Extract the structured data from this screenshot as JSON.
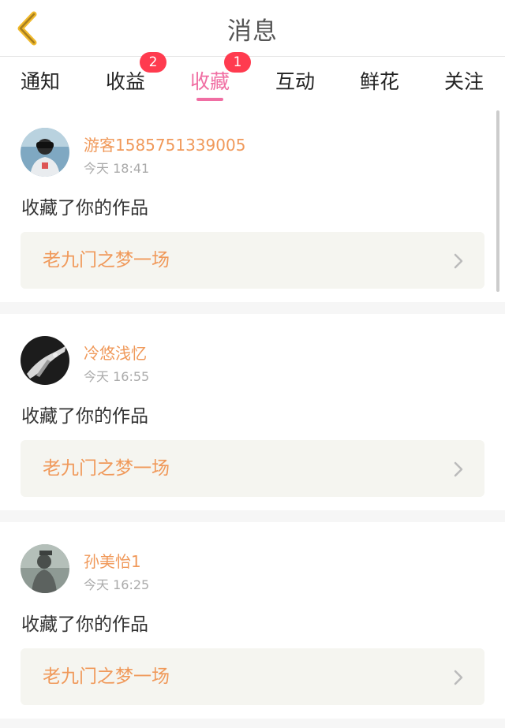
{
  "header": {
    "title": "消息",
    "back_icon": "chevron-left-icon",
    "accent_color": "#f0b92c"
  },
  "tabs": [
    {
      "label": "通知",
      "badge": ""
    },
    {
      "label": "收益",
      "badge": "2"
    },
    {
      "label": "收藏",
      "badge": "1",
      "active": true
    },
    {
      "label": "互动",
      "badge": ""
    },
    {
      "label": "鲜花",
      "badge": ""
    },
    {
      "label": "关注",
      "badge": ""
    }
  ],
  "notifications": [
    {
      "username": "游客1585751339005",
      "time": "今天 18:41",
      "action": "收藏了你的作品",
      "work_title": "老九门之梦一场"
    },
    {
      "username": "冷悠浅忆",
      "time": "今天 16:55",
      "action": "收藏了你的作品",
      "work_title": "老九门之梦一场"
    },
    {
      "username": "孙美怡1",
      "time": "今天 16:25",
      "action": "收藏了你的作品",
      "work_title": "老九门之梦一场"
    }
  ],
  "colors": {
    "active_tab": "#f06ea3",
    "badge": "#ff3b4f",
    "username": "#f0995a",
    "link_bg": "#f5f5f0"
  }
}
